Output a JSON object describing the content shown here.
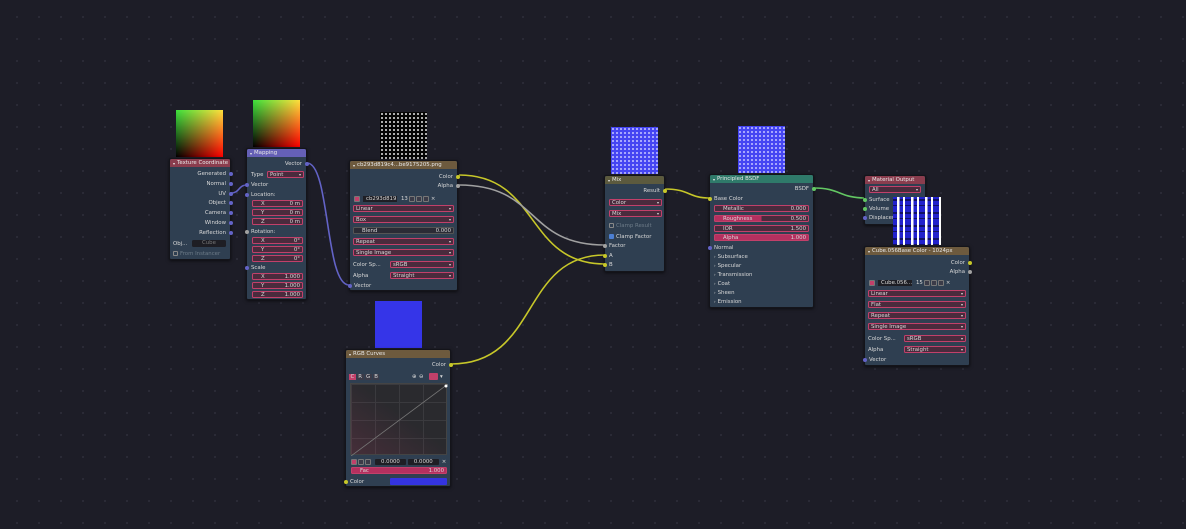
{
  "colors": {
    "bg": "#1d1d27",
    "node_body": "#2f3f51",
    "hdr_texcoord": "#8a3d4e",
    "hdr_mapping": "#6560b6",
    "hdr_image": "#6d5a3e",
    "hdr_mix": "#5c5a3e",
    "hdr_bsdf": "#2f7a6a",
    "hdr_output": "#8a3d4e",
    "wire_yellow": "#c7c729",
    "wire_gray": "#a1a1a1",
    "wire_blue": "#6363c7",
    "wire_green": "#63c763",
    "field_border": "#c2406a"
  },
  "texcoord": {
    "title": "Texture Coordinate",
    "outputs": [
      "Generated",
      "Normal",
      "UV",
      "Object",
      "Camera",
      "Window",
      "Reflection"
    ],
    "object_label": "Obj...",
    "object_value": "Cube",
    "from_instancer": "From Instancer"
  },
  "mapping": {
    "title": "Mapping",
    "out": "Vector",
    "type_label": "Type",
    "type_value": "Point",
    "in_vector": "Vector",
    "location": "Location:",
    "loc": [
      {
        "a": "X",
        "v": "0 m"
      },
      {
        "a": "Y",
        "v": "0 m"
      },
      {
        "a": "Z",
        "v": "0 m"
      }
    ],
    "rotation": "Rotation:",
    "rot": [
      {
        "a": "X",
        "v": "0°"
      },
      {
        "a": "Y",
        "v": "0°"
      },
      {
        "a": "Z",
        "v": "0°"
      }
    ],
    "scale": "Scale",
    "scl": [
      {
        "a": "X",
        "v": "1.000"
      },
      {
        "a": "Y",
        "v": "1.000"
      },
      {
        "a": "Z",
        "v": "1.000"
      }
    ]
  },
  "image": {
    "title": "cb293d819c4...be9175205.png",
    "out_color": "Color",
    "out_alpha": "Alpha",
    "file": "cb293d819...",
    "users": "13",
    "interp": "Linear",
    "proj": "Box",
    "blend_label": "Blend",
    "blend_value": "0.000",
    "ext": "Repeat",
    "source": "Single Image",
    "cs_label": "Color Sp...",
    "cs_value": "sRGB",
    "alpha_label": "Alpha",
    "alpha_value": "Straight",
    "in_vector": "Vector"
  },
  "curves": {
    "title": "RGB Curves",
    "out": "Color",
    "tabs": [
      "C",
      "R",
      "G",
      "B"
    ],
    "x_value": "0.0000",
    "y_value": "0.0000",
    "fac_label": "Fac",
    "fac_value": "1.000",
    "color_label": "Color"
  },
  "mix": {
    "title": "Mix",
    "out": "Result",
    "dtype": "Color",
    "blend": "Mix",
    "clamp_result": "Clamp Result",
    "clamp_factor": "Clamp Factor",
    "in_factor": "Factor",
    "in_a": "A",
    "in_b": "B"
  },
  "bsdf": {
    "title": "Principled BSDF",
    "out": "BSDF",
    "base_color": "Base Color",
    "fields": [
      {
        "label": "Metallic",
        "value": "0.000",
        "hot": false
      },
      {
        "label": "Roughness",
        "value": "0.500",
        "hot": false
      },
      {
        "label": "IOR",
        "value": "1.500",
        "hot": false
      },
      {
        "label": "Alpha",
        "value": "1.000",
        "hot": true
      }
    ],
    "normal": "Normal",
    "panels": [
      "Subsurface",
      "Specular",
      "Transmission",
      "Coat",
      "Sheen",
      "Emission"
    ]
  },
  "output": {
    "title": "Material Output",
    "target": "All",
    "inputs": [
      "Surface",
      "Volume",
      "Displacement"
    ]
  },
  "image2": {
    "title": "Cube.056Base Color - 1024px",
    "out_color": "Color",
    "out_alpha": "Alpha",
    "file": "Cube.056...",
    "users": "15",
    "interp": "Linear",
    "proj": "Flat",
    "ext": "Repeat",
    "source": "Single Image",
    "cs_label": "Color Sp...",
    "cs_value": "sRGB",
    "alpha_label": "Alpha",
    "alpha_value": "Straight",
    "in_vector": "Vector"
  }
}
